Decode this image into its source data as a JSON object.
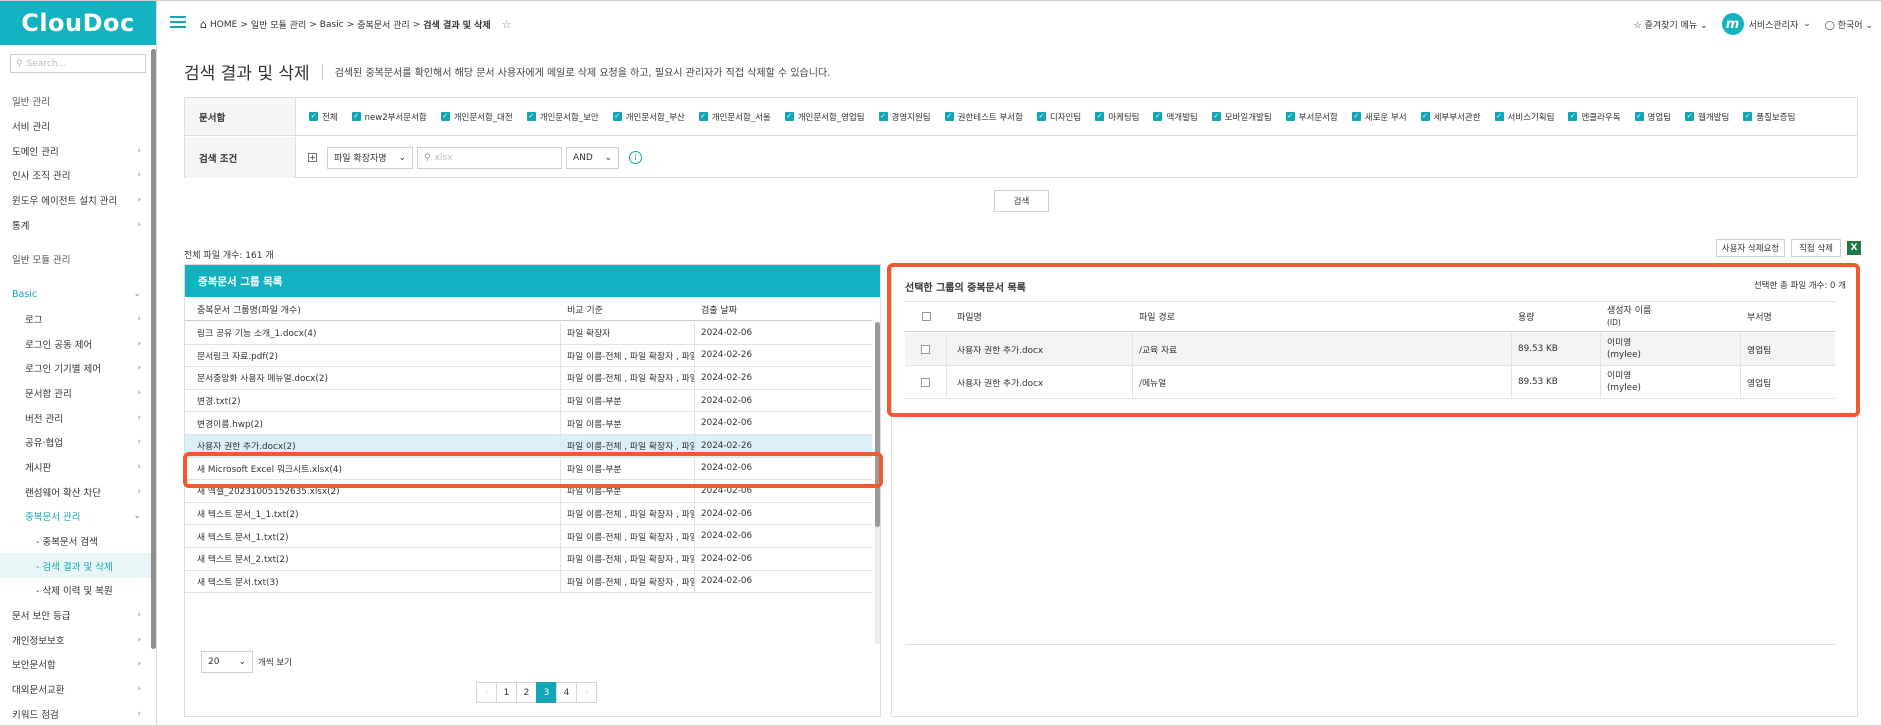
{
  "app": {
    "logo": "ClouDoc"
  },
  "sidebar": {
    "search_placeholder": "Search...",
    "items": [
      {
        "label": "일반 관리",
        "chev": ""
      },
      {
        "label": "서비 관리",
        "chev": ""
      },
      {
        "label": "도메인 관리",
        "chev": "›"
      },
      {
        "label": "인사 조직 관리",
        "chev": "›"
      },
      {
        "label": "윈도우 에이전트 설치 관리",
        "chev": "›"
      },
      {
        "label": "통계",
        "chev": "›"
      },
      {
        "label": "일반 모듈 관리",
        "chev": ""
      },
      {
        "label": "Basic",
        "chev": "⌄"
      },
      {
        "label": "로그",
        "chev": "›"
      },
      {
        "label": "로그인 공동 제어",
        "chev": "›"
      },
      {
        "label": "로그인 기기별 제어",
        "chev": "›"
      },
      {
        "label": "문서함 관리",
        "chev": "›"
      },
      {
        "label": "버전 관리",
        "chev": "›"
      },
      {
        "label": "공유·협업",
        "chev": "›"
      },
      {
        "label": "게시판",
        "chev": "›"
      },
      {
        "label": "랜섬웨어 확산 차단",
        "chev": "›"
      },
      {
        "label": "중복문서 관리",
        "chev": "⌄"
      },
      {
        "label": "- 중복문서 검색",
        "chev": ""
      },
      {
        "label": "- 검색 결과 및 삭제",
        "chev": ""
      },
      {
        "label": "- 삭제 이력 및 복원",
        "chev": ""
      },
      {
        "label": "문서 보안 등급",
        "chev": "›"
      },
      {
        "label": "개인정보보호",
        "chev": "›"
      },
      {
        "label": "보안문서함",
        "chev": "›"
      },
      {
        "label": "대외문서교환",
        "chev": "›"
      },
      {
        "label": "키워드 점검",
        "chev": "›"
      }
    ]
  },
  "topbar": {
    "crumbs": [
      "HOME",
      "일반 모듈 관리",
      "Basic",
      "중복문서 관리",
      "검색 결과 및 삭제"
    ],
    "favorites": "즐겨찾기 메뉴",
    "avatar_letter": "m",
    "user": "서비스관리자",
    "language": "한국어"
  },
  "page": {
    "title": "검색 결과 및 삭제",
    "description": "검색된 중복문서를 확인해서 해당 문서 사용자에게 메일로 삭제 요청을 하고, 필요시 관리자가 직접 삭제할 수 있습니다."
  },
  "filter": {
    "docbox_label": "문서함",
    "docboxes": [
      "전체",
      "new2부서문서함",
      "개인문서함_대전",
      "개인문서함_보안",
      "개인문서함_부산",
      "개인문서함_서울",
      "개인문서함_영업팀",
      "경영지원팀",
      "권한테스트 부서함",
      "디자인팀",
      "마케팅팀",
      "맥개발팀",
      "모바일개발팀",
      "부서문서함",
      "새로운 부서",
      "세부부서관한",
      "서비스기획팀",
      "엔클라우독",
      "영업팀",
      "웹개발팀",
      "품질보증팀"
    ],
    "cond_label": "검색 조건",
    "cond_select": "파일 확장자명",
    "cond_placeholder": "xlsx",
    "logic": "AND",
    "search_button": "검색"
  },
  "results": {
    "total": "전체 파일 개수: 161 개",
    "request_delete": "사용자 삭제요청",
    "direct_delete": "직접 삭제",
    "excel": "X"
  },
  "groups": {
    "title": "중복문서 그룹 목록",
    "columns": [
      "중복문서 그룹명(파일 개수)",
      "비교 기준",
      "검출 날짜"
    ],
    "rows": [
      [
        "링크 공유 기능 소개_1.docx(4)",
        "파일 확장자",
        "2024-02-06"
      ],
      [
        "문서링크 자료.pdf(2)",
        "파일 이름-전체 , 파일 확장자 , 파일",
        "2024-02-26"
      ],
      [
        "문서중앙화 사용자 메뉴얼.docx(2)",
        "파일 이름-전체 , 파일 확장자 , 파일",
        "2024-02-26"
      ],
      [
        "변경.txt(2)",
        "파일 이름-부분",
        "2024-02-06"
      ],
      [
        "변경이름.hwp(2)",
        "파일 이름-부분",
        "2024-02-06"
      ],
      [
        "사용자 권한 추가.docx(2)",
        "파일 이름-전체 , 파일 확장자 , 파일",
        "2024-02-26"
      ],
      [
        "새 Microsoft Excel 워크시트.xlsx(4)",
        "파일 이름-부분",
        "2024-02-06"
      ],
      [
        "새 엑셀_20231005152635.xlsx(2)",
        "파일 이름-부분",
        "2024-02-06"
      ],
      [
        "새 텍스트 문서_1_1.txt(2)",
        "파일 이름-전체 , 파일 확장자 , 파일",
        "2024-02-06"
      ],
      [
        "새 텍스트 문서_1.txt(2)",
        "파일 이름-전체 , 파일 확장자 , 파일",
        "2024-02-06"
      ],
      [
        "새 텍스트 문서_2.txt(2)",
        "파일 이름-전체 , 파일 확장자 , 파일",
        "2024-02-06"
      ],
      [
        "새 텍스트 문서.txt(3)",
        "파일 이름-전체 , 파일 확장자 , 파일",
        "2024-02-06"
      ]
    ],
    "page_size": "20",
    "page_size_label": "개씩 보기",
    "pages": [
      "‹",
      "1",
      "2",
      "3",
      "4",
      "›"
    ],
    "current_page": "3"
  },
  "detail": {
    "title": "선택한 그룹의 중복문서 목록",
    "selected_count": "선택한 총 파일 개수: 0 개",
    "columns": [
      "파일명",
      "파일 경로",
      "용량",
      "생성자 이름",
      "(ID)",
      "부서명"
    ],
    "rows": [
      {
        "name": "사용자 권한 추가.docx",
        "path": "/교육 자료",
        "size": "89.53 KB",
        "creator": "이미영",
        "id": "(mylee)",
        "dept": "영업팀"
      },
      {
        "name": "사용자 권한 추가.docx",
        "path": "/메뉴얼",
        "size": "89.53 KB",
        "creator": "이미영",
        "id": "(mylee)",
        "dept": "영업팀"
      }
    ]
  },
  "colors": {
    "accent": "#13b2c1",
    "highlight": "#ef5a2e",
    "selected_row": "#dbeff8"
  }
}
